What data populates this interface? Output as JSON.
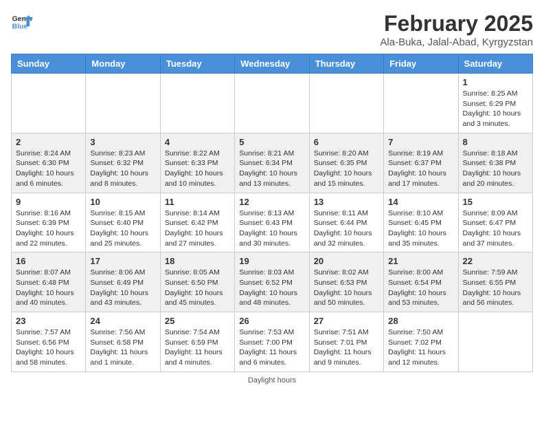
{
  "header": {
    "logo_line1": "General",
    "logo_line2": "Blue",
    "month_title": "February 2025",
    "location": "Ala-Buka, Jalal-Abad, Kyrgyzstan"
  },
  "days_of_week": [
    "Sunday",
    "Monday",
    "Tuesday",
    "Wednesday",
    "Thursday",
    "Friday",
    "Saturday"
  ],
  "weeks": [
    {
      "days": [
        {
          "num": "",
          "info": ""
        },
        {
          "num": "",
          "info": ""
        },
        {
          "num": "",
          "info": ""
        },
        {
          "num": "",
          "info": ""
        },
        {
          "num": "",
          "info": ""
        },
        {
          "num": "",
          "info": ""
        },
        {
          "num": "1",
          "info": "Sunrise: 8:25 AM\nSunset: 6:29 PM\nDaylight: 10 hours\nand 3 minutes."
        }
      ]
    },
    {
      "days": [
        {
          "num": "2",
          "info": "Sunrise: 8:24 AM\nSunset: 6:30 PM\nDaylight: 10 hours\nand 6 minutes."
        },
        {
          "num": "3",
          "info": "Sunrise: 8:23 AM\nSunset: 6:32 PM\nDaylight: 10 hours\nand 8 minutes."
        },
        {
          "num": "4",
          "info": "Sunrise: 8:22 AM\nSunset: 6:33 PM\nDaylight: 10 hours\nand 10 minutes."
        },
        {
          "num": "5",
          "info": "Sunrise: 8:21 AM\nSunset: 6:34 PM\nDaylight: 10 hours\nand 13 minutes."
        },
        {
          "num": "6",
          "info": "Sunrise: 8:20 AM\nSunset: 6:35 PM\nDaylight: 10 hours\nand 15 minutes."
        },
        {
          "num": "7",
          "info": "Sunrise: 8:19 AM\nSunset: 6:37 PM\nDaylight: 10 hours\nand 17 minutes."
        },
        {
          "num": "8",
          "info": "Sunrise: 8:18 AM\nSunset: 6:38 PM\nDaylight: 10 hours\nand 20 minutes."
        }
      ]
    },
    {
      "days": [
        {
          "num": "9",
          "info": "Sunrise: 8:16 AM\nSunset: 6:39 PM\nDaylight: 10 hours\nand 22 minutes."
        },
        {
          "num": "10",
          "info": "Sunrise: 8:15 AM\nSunset: 6:40 PM\nDaylight: 10 hours\nand 25 minutes."
        },
        {
          "num": "11",
          "info": "Sunrise: 8:14 AM\nSunset: 6:42 PM\nDaylight: 10 hours\nand 27 minutes."
        },
        {
          "num": "12",
          "info": "Sunrise: 8:13 AM\nSunset: 6:43 PM\nDaylight: 10 hours\nand 30 minutes."
        },
        {
          "num": "13",
          "info": "Sunrise: 8:11 AM\nSunset: 6:44 PM\nDaylight: 10 hours\nand 32 minutes."
        },
        {
          "num": "14",
          "info": "Sunrise: 8:10 AM\nSunset: 6:45 PM\nDaylight: 10 hours\nand 35 minutes."
        },
        {
          "num": "15",
          "info": "Sunrise: 8:09 AM\nSunset: 6:47 PM\nDaylight: 10 hours\nand 37 minutes."
        }
      ]
    },
    {
      "days": [
        {
          "num": "16",
          "info": "Sunrise: 8:07 AM\nSunset: 6:48 PM\nDaylight: 10 hours\nand 40 minutes."
        },
        {
          "num": "17",
          "info": "Sunrise: 8:06 AM\nSunset: 6:49 PM\nDaylight: 10 hours\nand 43 minutes."
        },
        {
          "num": "18",
          "info": "Sunrise: 8:05 AM\nSunset: 6:50 PM\nDaylight: 10 hours\nand 45 minutes."
        },
        {
          "num": "19",
          "info": "Sunrise: 8:03 AM\nSunset: 6:52 PM\nDaylight: 10 hours\nand 48 minutes."
        },
        {
          "num": "20",
          "info": "Sunrise: 8:02 AM\nSunset: 6:53 PM\nDaylight: 10 hours\nand 50 minutes."
        },
        {
          "num": "21",
          "info": "Sunrise: 8:00 AM\nSunset: 6:54 PM\nDaylight: 10 hours\nand 53 minutes."
        },
        {
          "num": "22",
          "info": "Sunrise: 7:59 AM\nSunset: 6:55 PM\nDaylight: 10 hours\nand 56 minutes."
        }
      ]
    },
    {
      "days": [
        {
          "num": "23",
          "info": "Sunrise: 7:57 AM\nSunset: 6:56 PM\nDaylight: 10 hours\nand 58 minutes."
        },
        {
          "num": "24",
          "info": "Sunrise: 7:56 AM\nSunset: 6:58 PM\nDaylight: 11 hours\nand 1 minute."
        },
        {
          "num": "25",
          "info": "Sunrise: 7:54 AM\nSunset: 6:59 PM\nDaylight: 11 hours\nand 4 minutes."
        },
        {
          "num": "26",
          "info": "Sunrise: 7:53 AM\nSunset: 7:00 PM\nDaylight: 11 hours\nand 6 minutes."
        },
        {
          "num": "27",
          "info": "Sunrise: 7:51 AM\nSunset: 7:01 PM\nDaylight: 11 hours\nand 9 minutes."
        },
        {
          "num": "28",
          "info": "Sunrise: 7:50 AM\nSunset: 7:02 PM\nDaylight: 11 hours\nand 12 minutes."
        },
        {
          "num": "",
          "info": ""
        }
      ]
    }
  ],
  "footer": "Daylight hours"
}
